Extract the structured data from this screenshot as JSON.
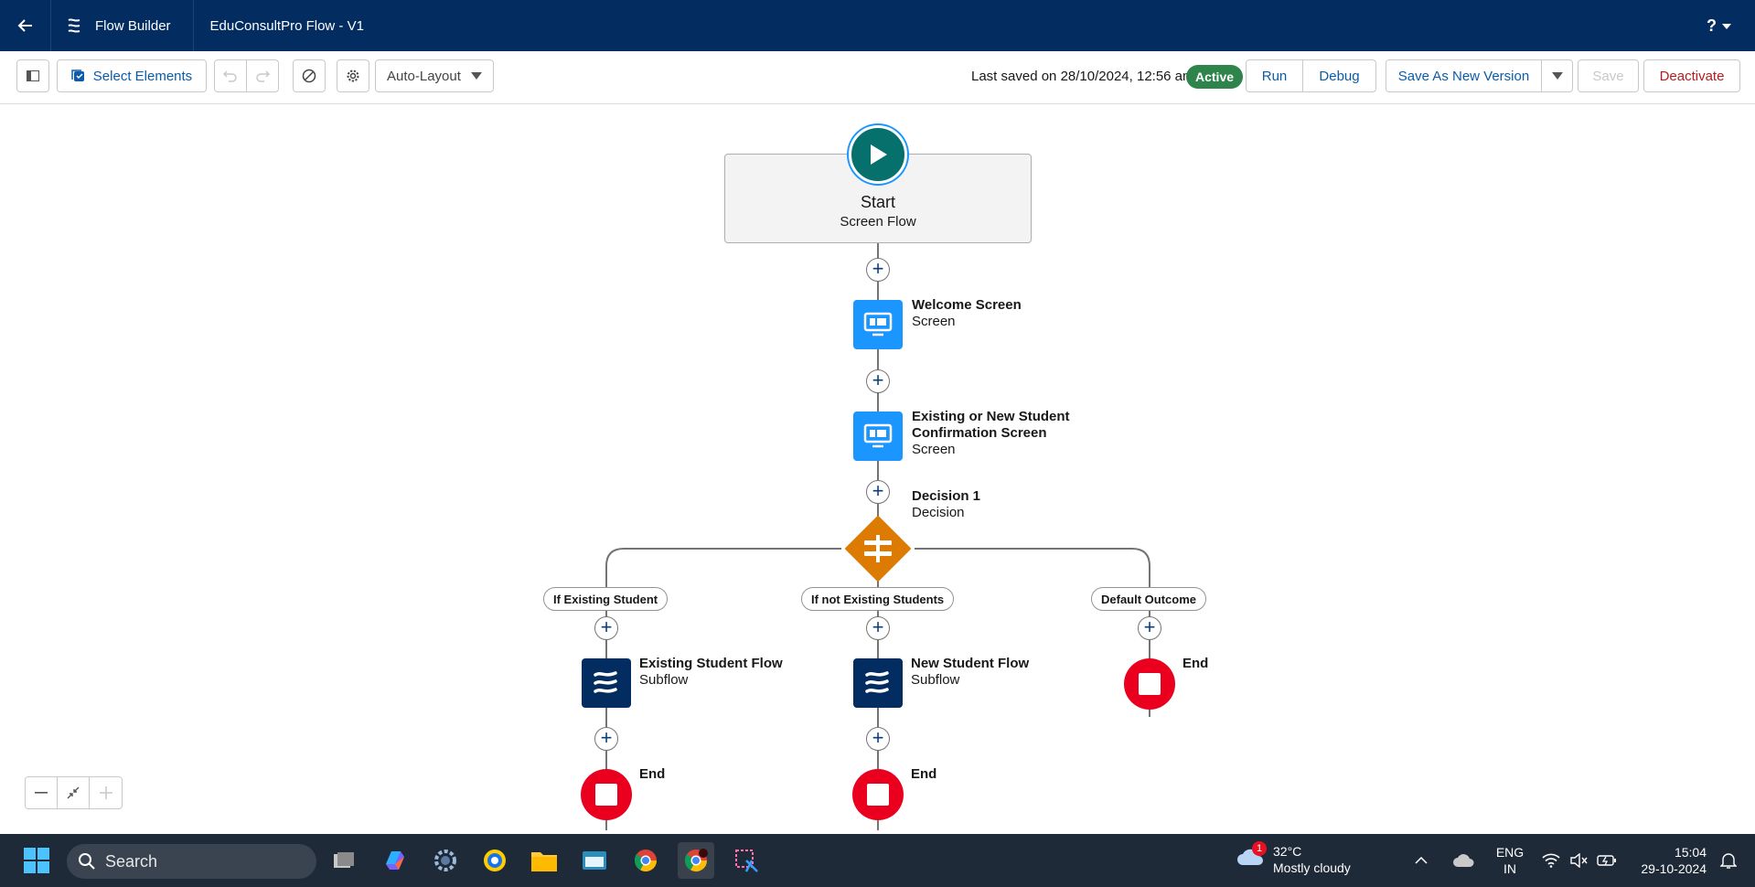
{
  "header": {
    "app_name": "Flow Builder",
    "flow_title": "EduConsultPro Flow - V1",
    "help": "?"
  },
  "toolbar": {
    "select_elements": "Select Elements",
    "layout_mode": "Auto-Layout",
    "last_saved": "Last saved on 28/10/2024, 12:56 am",
    "status_badge": "Active",
    "run": "Run",
    "debug": "Debug",
    "save_as_new_version": "Save As New Version",
    "save": "Save",
    "deactivate": "Deactivate"
  },
  "canvas": {
    "start": {
      "title": "Start",
      "type": "Screen Flow"
    },
    "welcome": {
      "title": "Welcome Screen",
      "type": "Screen"
    },
    "confirmation": {
      "title_line1": "Existing or New Student",
      "title_line2": "Confirmation Screen",
      "type": "Screen"
    },
    "decision": {
      "title": "Decision 1",
      "type": "Decision"
    },
    "outcomes": {
      "existing": "If Existing Student",
      "not_existing": "If not Existing Students",
      "default": "Default Outcome"
    },
    "existing_subflow": {
      "title": "Existing Student Flow",
      "type": "Subflow"
    },
    "new_subflow": {
      "title": "New Student Flow",
      "type": "Subflow"
    },
    "end_label": "End"
  },
  "taskbar": {
    "search_placeholder": "Search",
    "weather_temp": "32°C",
    "weather_desc": "Mostly cloudy",
    "weather_badge": "1",
    "lang_line1": "ENG",
    "lang_line2": "IN",
    "time": "15:04",
    "date": "29-10-2024"
  },
  "colors": {
    "header_bg": "#032d60",
    "brand_blue": "#0b5cab",
    "active_green": "#2e844a",
    "screen_blue": "#1b96ff",
    "decision_orange": "#dd7a01",
    "end_red": "#ea001e",
    "start_teal": "#06706c"
  }
}
